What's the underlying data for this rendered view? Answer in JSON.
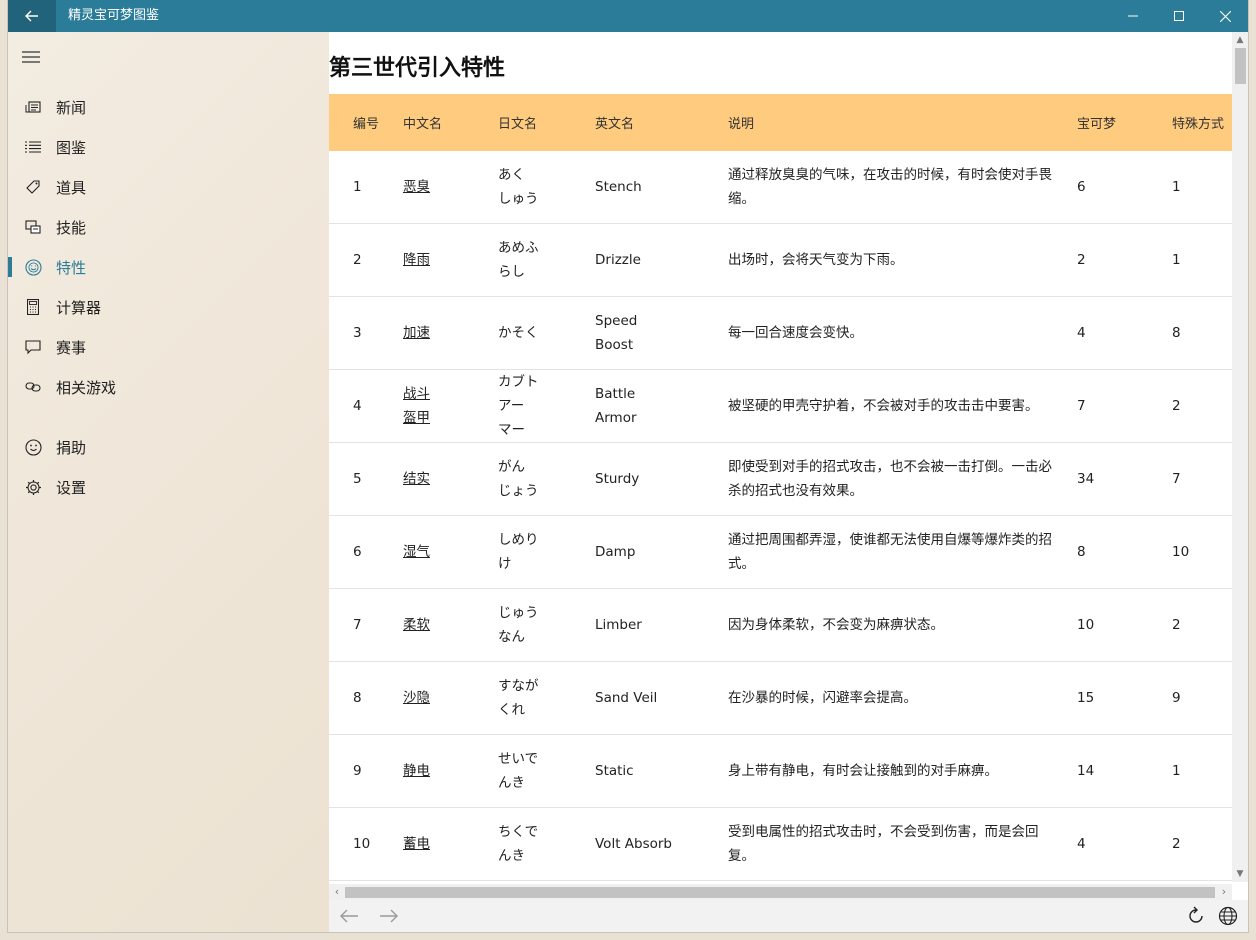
{
  "app": {
    "title": "精灵宝可梦图鉴"
  },
  "sidebar": {
    "items": [
      {
        "label": "新闻",
        "icon": "news-icon"
      },
      {
        "label": "图鉴",
        "icon": "list-icon"
      },
      {
        "label": "道具",
        "icon": "tag-icon"
      },
      {
        "label": "技能",
        "icon": "skill-icon"
      },
      {
        "label": "特性",
        "icon": "smile-icon"
      },
      {
        "label": "计算器",
        "icon": "calculator-icon"
      },
      {
        "label": "赛事",
        "icon": "chat-icon"
      },
      {
        "label": "相关游戏",
        "icon": "link-icon"
      },
      {
        "label": "捐助",
        "icon": "donate-smile-icon"
      },
      {
        "label": "设置",
        "icon": "gear-icon"
      }
    ],
    "active_index": 4
  },
  "main": {
    "title": "第三世代引入特性",
    "columns": [
      "编号",
      "中文名",
      "日文名",
      "英文名",
      "说明",
      "宝可梦",
      "特殊方式"
    ],
    "rows": [
      {
        "id": "1",
        "zh": "恶臭",
        "ja": "あく\nしゅう",
        "en": "Stench",
        "desc": "通过释放臭臭的气味，在攻击的时候，有时会使对手畏缩。",
        "count": "6",
        "special": "1"
      },
      {
        "id": "2",
        "zh": "降雨",
        "ja": "あめふ\nらし",
        "en": "Drizzle",
        "desc": "出场时，会将天气变为下雨。",
        "count": "2",
        "special": "1"
      },
      {
        "id": "3",
        "zh": "加速",
        "ja": "かそく",
        "en": "Speed\nBoost",
        "desc": "每一回合速度会变快。",
        "count": "4",
        "special": "8"
      },
      {
        "id": "4",
        "zh": "战斗\n盔甲",
        "ja": "カブト\nアー\nマー",
        "en": "Battle\nArmor",
        "desc": "被坚硬的甲壳守护着，不会被对手的攻击击中要害。",
        "count": "7",
        "special": "2"
      },
      {
        "id": "5",
        "zh": "结实",
        "ja": "がん\nじょう",
        "en": "Sturdy",
        "desc": "即使受到对手的招式攻击，也不会被一击打倒。一击必杀的招式也没有效果。",
        "count": "34",
        "special": "7"
      },
      {
        "id": "6",
        "zh": "湿气",
        "ja": "しめり\nけ",
        "en": "Damp",
        "desc": "通过把周围都弄湿，使谁都无法使用自爆等爆炸类的招式。",
        "count": "8",
        "special": "10"
      },
      {
        "id": "7",
        "zh": "柔软",
        "ja": "じゅう\nなん",
        "en": "Limber",
        "desc": "因为身体柔软，不会变为麻痹状态。",
        "count": "10",
        "special": "2"
      },
      {
        "id": "8",
        "zh": "沙隐",
        "ja": "すなが\nくれ",
        "en": "Sand Veil",
        "desc": "在沙暴的时候，闪避率会提高。",
        "count": "15",
        "special": "9"
      },
      {
        "id": "9",
        "zh": "静电",
        "ja": "せいで\nんき",
        "en": "Static",
        "desc": "身上带有静电，有时会让接触到的对手麻痹。",
        "count": "14",
        "special": "1"
      },
      {
        "id": "10",
        "zh": "蓄电",
        "ja": "ちくで\nんき",
        "en": "Volt Absorb",
        "desc": "受到电属性的招式攻击时，不会受到伤害，而是会回复。",
        "count": "4",
        "special": "2"
      }
    ]
  },
  "colors": {
    "titlebar": "#2b7c99",
    "accent": "#2b7c99",
    "table_header": "#ffcb7f"
  }
}
